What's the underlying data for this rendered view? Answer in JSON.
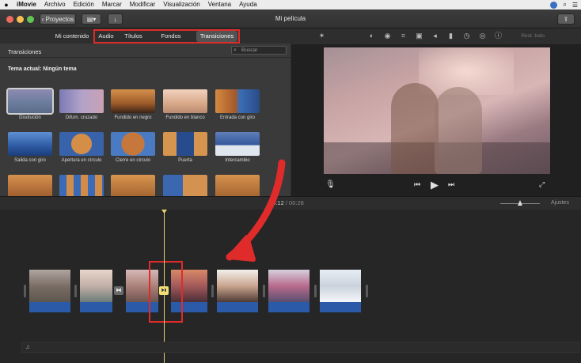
{
  "menubar": {
    "app_name": "iMovie",
    "items": [
      "Archivo",
      "Edición",
      "Marcar",
      "Modificar",
      "Visualización",
      "Ventana",
      "Ayuda"
    ]
  },
  "toolbar": {
    "projects_label": "‹ Proyectos",
    "window_title": "Mi película"
  },
  "browser_tabs": [
    "Mi contenido",
    "Audio",
    "Títulos",
    "Fondos",
    "Transiciones"
  ],
  "browser": {
    "section_title": "Transiciones",
    "search_placeholder": "Buscar",
    "current_theme": "Tema actual: Ningún tema",
    "transitions": [
      {
        "label": "Disolución",
        "selected": true
      },
      {
        "label": "Difum. cruzado"
      },
      {
        "label": "Fundido en negro"
      },
      {
        "label": "Fundido en blanco"
      },
      {
        "label": "Entrada con giro"
      },
      {
        "label": "Salida con giro"
      },
      {
        "label": "Apertura en círculo"
      },
      {
        "label": "Cierre en círculo"
      },
      {
        "label": "Puerta"
      },
      {
        "label": "Intercambio"
      },
      {
        "label": ""
      },
      {
        "label": ""
      },
      {
        "label": ""
      },
      {
        "label": ""
      },
      {
        "label": ""
      }
    ]
  },
  "viewer": {
    "reset_label": "Rest. todo"
  },
  "timeline": {
    "current_time": "00:12",
    "separator": " / ",
    "total_time": "00:28",
    "settings_label": "Ajustes"
  },
  "colors": {
    "highlight_red": "#e02b2b",
    "playhead_yellow": "#e6d26e",
    "audio_blue": "#2a5aa8"
  }
}
